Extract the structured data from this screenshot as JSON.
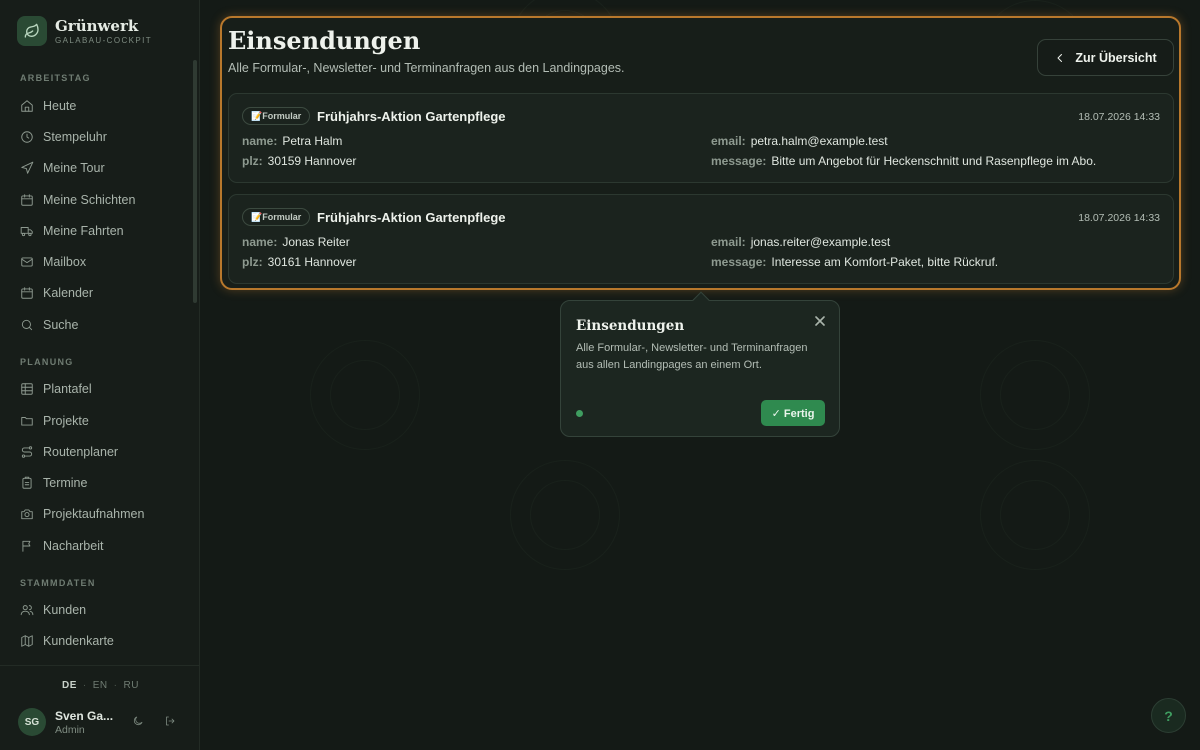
{
  "brand": {
    "name": "Grünwerk",
    "subtitle": "GALABAU-COCKPIT"
  },
  "sidebar": {
    "sections": [
      {
        "label": "ARBEITSTAG",
        "items": [
          {
            "label": "Heute",
            "icon": "home-icon"
          },
          {
            "label": "Stempeluhr",
            "icon": "clock-icon"
          },
          {
            "label": "Meine Tour",
            "icon": "navigation-icon"
          },
          {
            "label": "Meine Schichten",
            "icon": "calendar-icon"
          },
          {
            "label": "Meine Fahrten",
            "icon": "truck-icon"
          },
          {
            "label": "Mailbox",
            "icon": "mail-icon"
          },
          {
            "label": "Kalender",
            "icon": "calendar-icon"
          },
          {
            "label": "Suche",
            "icon": "search-icon"
          }
        ]
      },
      {
        "label": "PLANUNG",
        "items": [
          {
            "label": "Plantafel",
            "icon": "grid-icon"
          },
          {
            "label": "Projekte",
            "icon": "folder-icon"
          },
          {
            "label": "Routenplaner",
            "icon": "route-icon"
          },
          {
            "label": "Termine",
            "icon": "clipboard-icon"
          },
          {
            "label": "Projektaufnahmen",
            "icon": "camera-icon"
          },
          {
            "label": "Nacharbeit",
            "icon": "flag-icon"
          }
        ]
      },
      {
        "label": "STAMMDATEN",
        "items": [
          {
            "label": "Kunden",
            "icon": "users-icon"
          },
          {
            "label": "Kundenkarte",
            "icon": "map-icon"
          }
        ]
      }
    ],
    "languages": [
      "DE",
      "EN",
      "RU"
    ],
    "active_language": "DE",
    "user": {
      "initials": "SG",
      "name": "Sven Ga...",
      "role": "Admin"
    }
  },
  "main": {
    "title": "Einsendungen",
    "subtitle": "Alle Formular-, Newsletter- und Terminanfragen aus den Landingpages.",
    "back_button": "Zur Übersicht",
    "submissions": [
      {
        "badge": "📝Formular",
        "title": "Frühjahrs-Aktion Gartenpflege",
        "timestamp": "18.07.2026 14:33",
        "fields": [
          {
            "key": "name:",
            "value": "Petra Halm"
          },
          {
            "key": "email:",
            "value": "petra.halm@example.test"
          },
          {
            "key": "plz:",
            "value": "30159 Hannover"
          },
          {
            "key": "message:",
            "value": "Bitte um Angebot für Heckenschnitt und Rasenpflege im Abo."
          }
        ]
      },
      {
        "badge": "📝Formular",
        "title": "Frühjahrs-Aktion Gartenpflege",
        "timestamp": "18.07.2026 14:33",
        "fields": [
          {
            "key": "name:",
            "value": "Jonas Reiter"
          },
          {
            "key": "email:",
            "value": "jonas.reiter@example.test"
          },
          {
            "key": "plz:",
            "value": "30161 Hannover"
          },
          {
            "key": "message:",
            "value": "Interesse am Komfort-Paket, bitte Rückruf."
          }
        ]
      }
    ]
  },
  "popover": {
    "title": "Einsendungen",
    "text": "Alle Formular-, Newsletter- und Terminanfragen aus allen Landingpages an einem Ort.",
    "done_button": "✓ Fertig"
  },
  "help": {
    "label": "?"
  },
  "colors": {
    "accent": "#2f8a4f",
    "highlight_border": "#b8782c",
    "background": "#141a16"
  }
}
